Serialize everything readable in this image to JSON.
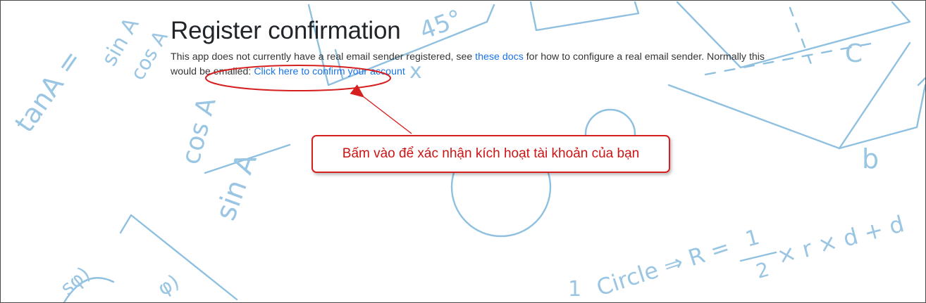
{
  "page": {
    "title": "Register confirmation",
    "intro_before_link": "This app does not currently have a real email sender registered, see ",
    "docs_link": "these docs",
    "intro_after_link": " for how to configure a real email sender. Normally this would be emailed: ",
    "confirm_link": "Click here to confirm your account"
  },
  "annotation": {
    "callout_text": "Bấm vào để xác nhận kích hoạt tài khoản của bạn",
    "color": "#d61f1f"
  },
  "background_doodles": {
    "formula_tan": "tanA =",
    "formula_sin": "sin A",
    "formula_cos_top": "cos A",
    "formula_cos": "cos A",
    "formula_sin_bottom": "sin A",
    "angle": "45°",
    "var_x": "x",
    "var_c": "C",
    "var_b": "b",
    "formula_circle": "Circle ⇒ R =",
    "formula_half": "1",
    "formula_half_den": "2",
    "formula_rest": "× r × d + d",
    "one": "1",
    "frag_1": "sφ)",
    "frag_2": "φ)"
  }
}
